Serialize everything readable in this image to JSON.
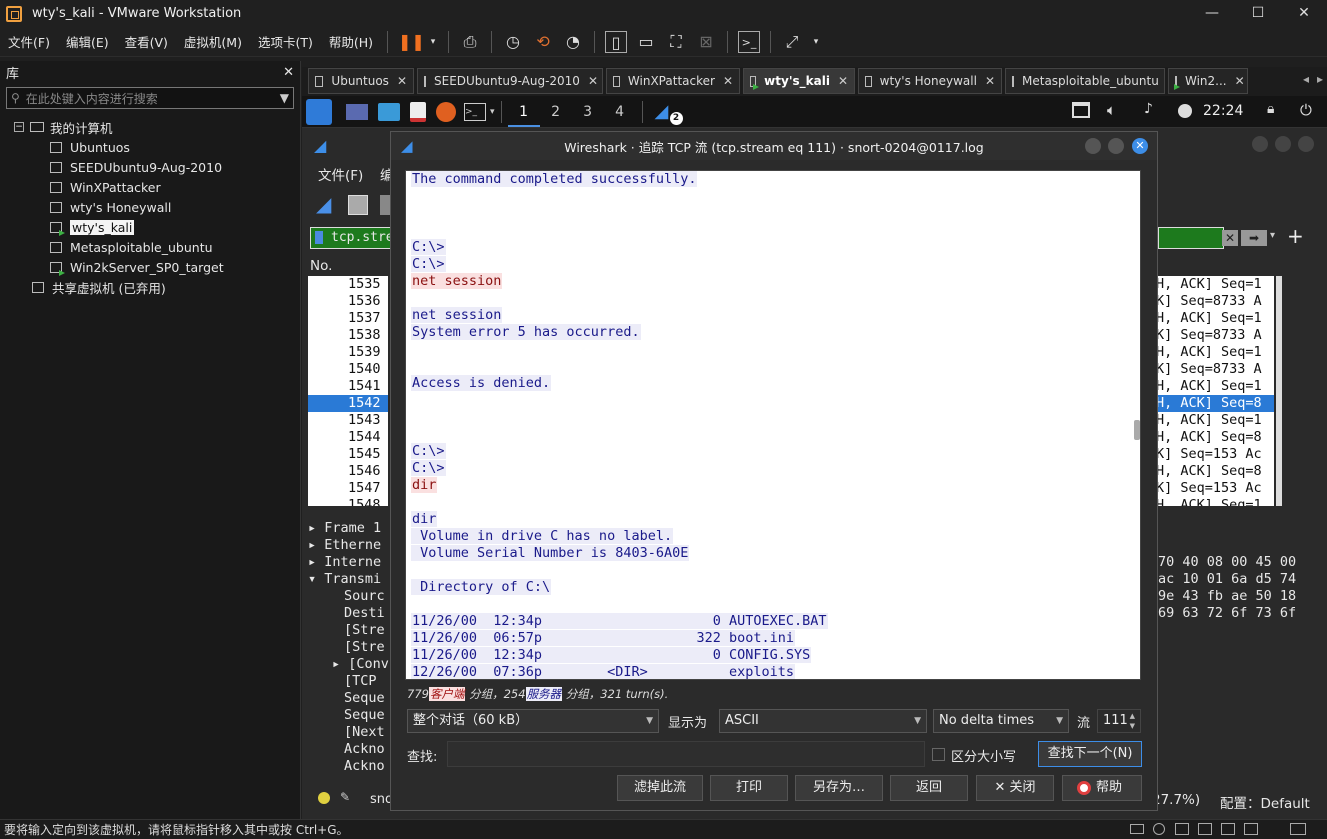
{
  "window": {
    "title": "wty's_kali - VMware Workstation"
  },
  "menu": [
    "文件(F)",
    "编辑(E)",
    "查看(V)",
    "虚拟机(M)",
    "选项卡(T)",
    "帮助(H)"
  ],
  "library": {
    "header": "库",
    "search_placeholder": "在此处键入内容进行搜索",
    "root": "我的计算机",
    "vms": [
      "Ubuntuos",
      "SEEDUbuntu9-Aug-2010",
      "WinXPattacker",
      "wty's Honeywall",
      "wty's_kali",
      "Metasploitable_ubuntu",
      "Win2kServer_SP0_target"
    ],
    "shared": "共享虚拟机 (已弃用)"
  },
  "tabs": [
    "Ubuntuos",
    "SEEDUbuntu9-Aug-2010",
    "WinXPattacker",
    "wty's_kali",
    "wty's Honeywall",
    "Metasploitable_ubuntu",
    "Win2..."
  ],
  "kali": {
    "workspaces": [
      "1",
      "2",
      "3",
      "4"
    ],
    "badge": "2",
    "clock": "22:24"
  },
  "wireshark": {
    "menu_file": "文件(F)",
    "menu_edit": "编",
    "filter": "tcp.strea",
    "col_no": "No.",
    "packet_numbers": [
      "1535",
      "1536",
      "1537",
      "1538",
      "1539",
      "1540",
      "1541",
      "1542",
      "1543",
      "1544",
      "1545",
      "1546",
      "1547",
      "1548"
    ],
    "packet_info": [
      "H, ACK] Seq=1",
      "K] Seq=8733 A",
      "H, ACK] Seq=1",
      "K] Seq=8733 A",
      "H, ACK] Seq=1",
      "K] Seq=8733 A",
      "H, ACK] Seq=1",
      "H, ACK] Seq=8",
      "H, ACK] Seq=1",
      "H, ACK] Seq=8",
      "K] Seq=153 Ac",
      "H, ACK] Seq=8",
      "K] Seq=153 Ac",
      "H, ACK] Seq=1"
    ],
    "tree": [
      "Frame 1",
      "Etherne",
      "Interne",
      "Transmi",
      "Sourc",
      "Desti",
      "[Stre",
      "[Stre",
      "[Conv",
      "[TCP ",
      "Seque",
      "Seque",
      "[Next",
      "Ackno",
      "Ackno"
    ],
    "hex": [
      "70 40 08 00 45 00",
      "ac 10 01 6a d5 74",
      "9e 43 fb ae 50 18",
      "69 63 72 6f 73 6f"
    ],
    "status_file": "sno",
    "status_pct": "27.7%)",
    "status_profile": "配置：Default"
  },
  "dialog": {
    "title": "Wireshark · 追踪 TCP 流 (tcp.stream eq 111) · snort-0204@0117.log",
    "lines": [
      {
        "t": "The command completed successfully.",
        "s": "srv"
      },
      {
        "t": "",
        "s": ""
      },
      {
        "t": "",
        "s": ""
      },
      {
        "t": "",
        "s": ""
      },
      {
        "t": "C:\\>",
        "s": "srv"
      },
      {
        "t": "C:\\>",
        "s": "srv"
      },
      {
        "t": "net session",
        "s": "cli"
      },
      {
        "t": "",
        "s": ""
      },
      {
        "t": "net session",
        "s": "srv"
      },
      {
        "t": "System error 5 has occurred.",
        "s": "srv"
      },
      {
        "t": "",
        "s": ""
      },
      {
        "t": "",
        "s": ""
      },
      {
        "t": "Access is denied.",
        "s": "srv"
      },
      {
        "t": "",
        "s": ""
      },
      {
        "t": "",
        "s": ""
      },
      {
        "t": "",
        "s": ""
      },
      {
        "t": "C:\\>",
        "s": "srv"
      },
      {
        "t": "C:\\>",
        "s": "srv"
      },
      {
        "t": "dir",
        "s": "cli"
      },
      {
        "t": "",
        "s": ""
      },
      {
        "t": "dir",
        "s": "srv"
      },
      {
        "t": " Volume in drive C has no label.",
        "s": "srv"
      },
      {
        "t": " Volume Serial Number is 8403-6A0E",
        "s": "srv"
      },
      {
        "t": "",
        "s": ""
      },
      {
        "t": " Directory of C:\\",
        "s": "srv"
      },
      {
        "t": "",
        "s": ""
      },
      {
        "t": "11/26/00  12:34p                     0 AUTOEXEC.BAT",
        "s": "srv"
      },
      {
        "t": "11/26/00  06:57p                   322 boot.ini",
        "s": "srv"
      },
      {
        "t": "11/26/00  12:34p                     0 CONFIG.SYS",
        "s": "srv"
      },
      {
        "t": "12/26/00  07:36p        <DIR>          exploits",
        "s": "srv"
      }
    ],
    "summary_client_count": "779",
    "summary_client": "客户端",
    "summary_mid": "分组，254",
    "summary_server": "服务器",
    "summary_tail": "分组，321 turn(s).",
    "conv_select": "整个对话（60 kB）",
    "show_as_label": "显示为",
    "show_as": "ASCII",
    "delta": "No delta times",
    "stream_label": "流",
    "stream_value": "111",
    "find_label": "查找:",
    "case_label": "区分大小写",
    "find_next": "查找下一个(N)",
    "buttons": [
      "滤掉此流",
      "打印",
      "另存为…",
      "返回",
      "✕ 关闭",
      "帮助"
    ]
  },
  "statusbar": "要将输入定向到该虚拟机，请将鼠标指针移入其中或按 Ctrl+G。"
}
